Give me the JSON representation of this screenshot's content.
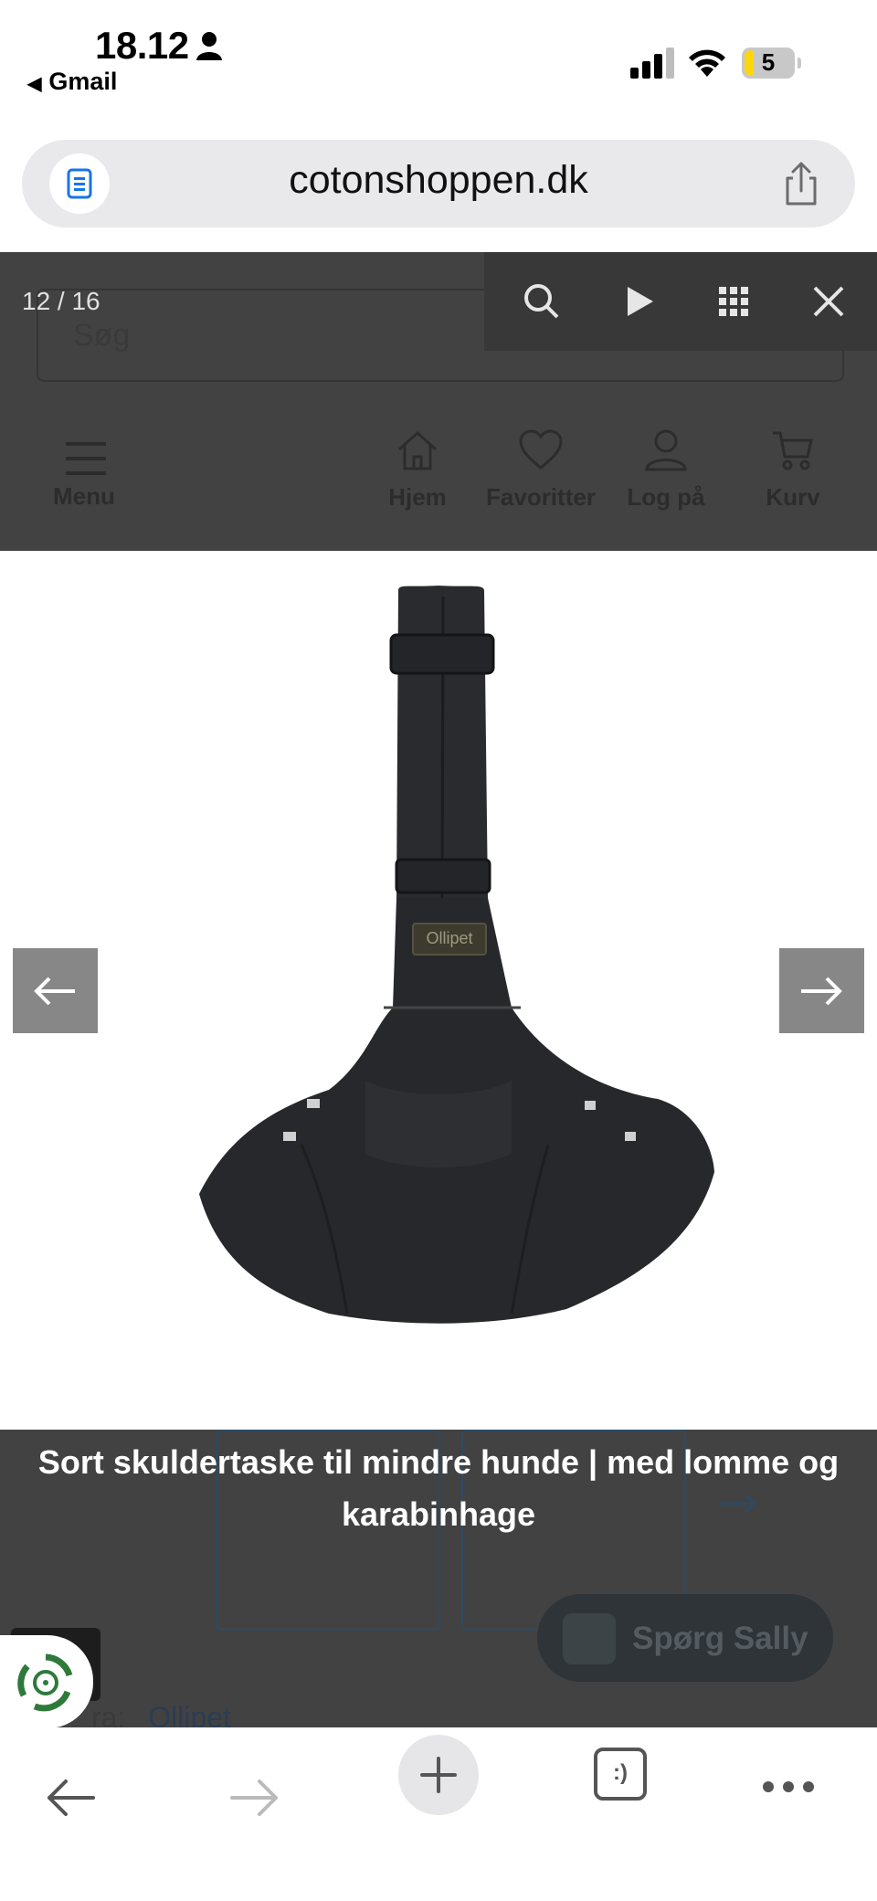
{
  "status_bar": {
    "time": "18.12",
    "back_app": "Gmail",
    "battery_level": "5",
    "icons": [
      "person-icon",
      "signal-icon",
      "wifi-icon",
      "battery-icon"
    ]
  },
  "browser": {
    "url": "cotonshoppen.dk",
    "icons": [
      "reader-icon",
      "share-icon"
    ]
  },
  "website": {
    "search_placeholder": "Søg",
    "menu_label": "Menu",
    "nav": [
      {
        "label": "Hjem",
        "icon": "home-icon"
      },
      {
        "label": "Favoritter",
        "icon": "heart-icon"
      },
      {
        "label": "Log på",
        "icon": "user-icon"
      },
      {
        "label": "Kurv",
        "icon": "cart-icon"
      }
    ],
    "brand_prefix": "ra:",
    "brand_name": "Ollipet",
    "chat_button": "Spørg Sally"
  },
  "lightbox": {
    "counter": "12 / 16",
    "toolbar": [
      "search-icon",
      "play-icon",
      "grid-icon",
      "close-icon"
    ],
    "product_label": "Ollipet",
    "caption": "Sort skuldertaske til mindre hunde | med lomme og karabinhage",
    "accent": "#424242"
  },
  "bottom_bar": {
    "icons": [
      "back-arrow-icon",
      "forward-arrow-icon",
      "new-tab-icon",
      "tabs-icon",
      "more-icon"
    ],
    "tabs_glyph": ":)"
  }
}
